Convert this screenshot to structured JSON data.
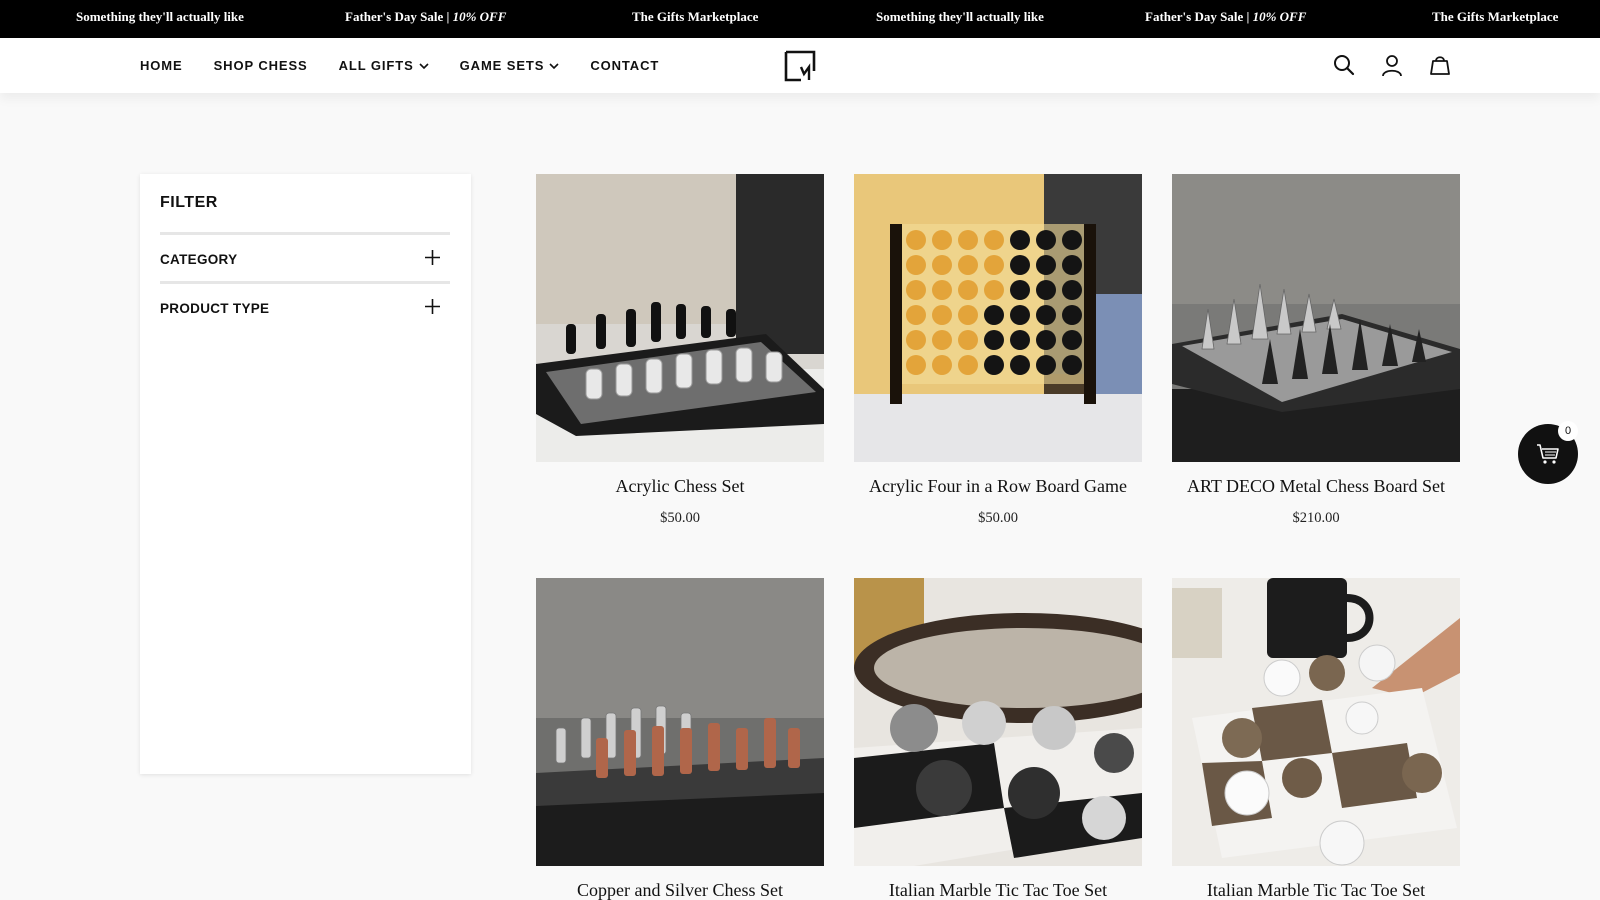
{
  "announcements": [
    {
      "text": "Something they'll actually like"
    },
    {
      "text": "Father's Day Sale | ",
      "em": "10% OFF"
    },
    {
      "text": "The Gifts Marketplace"
    },
    {
      "text": "Something they'll actually like"
    },
    {
      "text": "Father's Day Sale | ",
      "em": "10% OFF"
    },
    {
      "text": "The Gifts Marketplace"
    }
  ],
  "nav": {
    "home": "HOME",
    "shop_chess": "SHOP CHESS",
    "all_gifts": "ALL GIFTS",
    "game_sets": "GAME SETS",
    "contact": "CONTACT"
  },
  "icons": {
    "logo": "brand-logo-icon",
    "search": "search-icon",
    "account": "user-icon",
    "bag": "shopping-bag-icon",
    "cart": "cart-icon",
    "expand": "plus-icon",
    "dropdown": "chevron-down-icon"
  },
  "filter": {
    "title": "FILTER",
    "groups": [
      {
        "label": "CATEGORY"
      },
      {
        "label": "PRODUCT TYPE"
      }
    ]
  },
  "products": [
    {
      "name": "Acrylic Chess Set",
      "price": "$50.00"
    },
    {
      "name": "Acrylic Four in a Row Board Game",
      "price": "$50.00"
    },
    {
      "name": "ART DECO Metal Chess Board Set",
      "price": "$210.00"
    },
    {
      "name": "Copper and Silver Chess Set",
      "price": ""
    },
    {
      "name": "Italian Marble Tic Tac Toe Set",
      "price": ""
    },
    {
      "name": "Italian Marble Tic Tac Toe Set",
      "price": ""
    }
  ],
  "floating_cart": {
    "count": "0"
  },
  "colors": {
    "announce_bg": "#000000",
    "header_bg": "#ffffff",
    "page_bg": "#f9f9f9",
    "cart_button": "#111111"
  }
}
